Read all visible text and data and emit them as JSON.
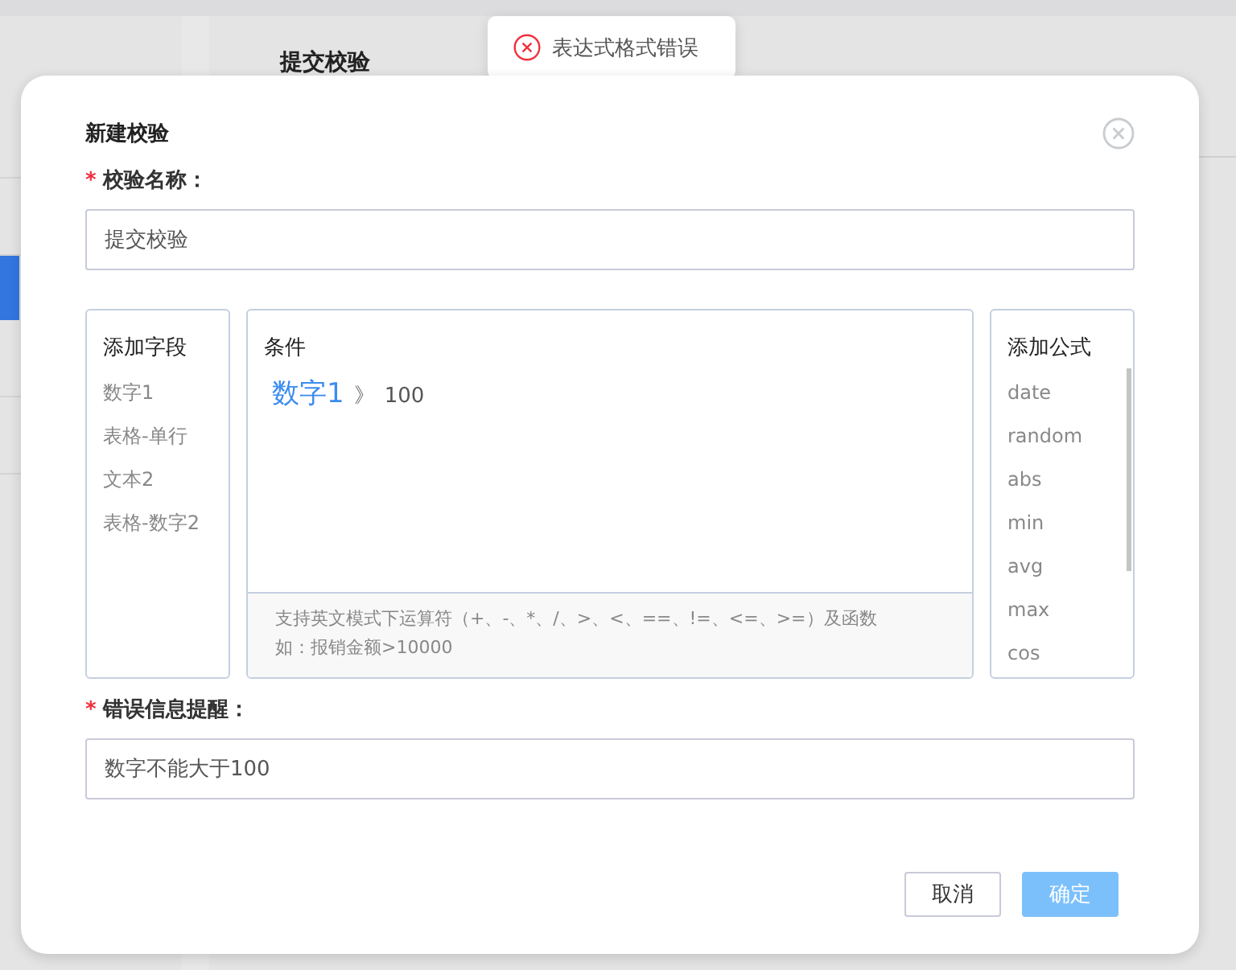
{
  "background": {
    "page_title": "提交校验"
  },
  "toast": {
    "kind": "error",
    "message": "表达式格式错误"
  },
  "dialog": {
    "title": "新建校验",
    "name_field": {
      "required_mark": "*",
      "label": "校验名称：",
      "value": "提交校验"
    },
    "fields_panel": {
      "title": "添加字段",
      "items": [
        "数字1",
        "表格-单行",
        "文本2",
        "表格-数字2"
      ]
    },
    "condition_panel": {
      "title": "条件",
      "tokens": [
        {
          "kind": "field",
          "text": "数字1"
        },
        {
          "kind": "operator",
          "text": "》"
        },
        {
          "kind": "literal",
          "text": "100"
        }
      ],
      "hint_lines": [
        "支持英文模式下运算符（+、-、*、/、>、<、==、!=、<=、>=）及函数",
        "如：报销金额>10000"
      ]
    },
    "formula_panel": {
      "title": "添加公式",
      "items": [
        "date",
        "random",
        "abs",
        "min",
        "avg",
        "max",
        "cos"
      ]
    },
    "error_field": {
      "required_mark": "*",
      "label": "错误信息提醒：",
      "value": "数字不能大于100"
    },
    "buttons": [
      {
        "kind": "secondary",
        "label": "取消",
        "disabled": false
      },
      {
        "kind": "primary",
        "label": "确定",
        "disabled": true
      }
    ]
  }
}
